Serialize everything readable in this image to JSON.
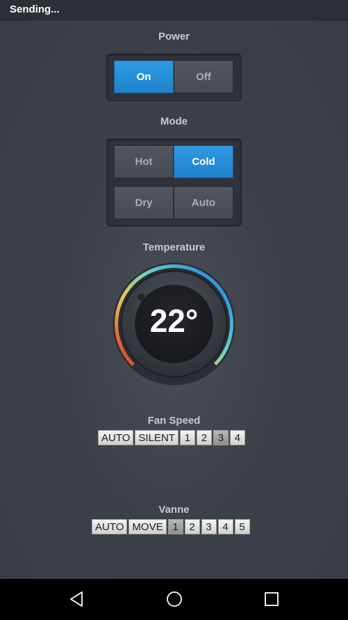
{
  "status": {
    "text": "Sending..."
  },
  "power": {
    "label": "Power",
    "options": [
      {
        "label": "On",
        "active": true
      },
      {
        "label": "Off",
        "active": false
      }
    ]
  },
  "mode": {
    "label": "Mode",
    "options": [
      {
        "label": "Hot",
        "active": false
      },
      {
        "label": "Cold",
        "active": true
      },
      {
        "label": "Dry",
        "active": false
      },
      {
        "label": "Auto",
        "active": false
      }
    ]
  },
  "temperature": {
    "label": "Temperature",
    "value": "22°"
  },
  "fan_speed": {
    "label": "Fan Speed",
    "options": [
      "AUTO",
      "SILENT",
      "1",
      "2",
      "3",
      "4"
    ],
    "selected": "3"
  },
  "vanne": {
    "label": "Vanne",
    "options": [
      "AUTO",
      "MOVE",
      "1",
      "2",
      "3",
      "4",
      "5"
    ],
    "selected": "1"
  },
  "navbar": {
    "icons": [
      "back-icon",
      "home-icon",
      "recents-icon"
    ]
  },
  "colors": {
    "accent": "#2a90dc",
    "background": "#3a3e46",
    "dial_gradient": [
      "#2f9ae3",
      "#6fd0c0",
      "#e8c85a",
      "#e2542c"
    ]
  }
}
